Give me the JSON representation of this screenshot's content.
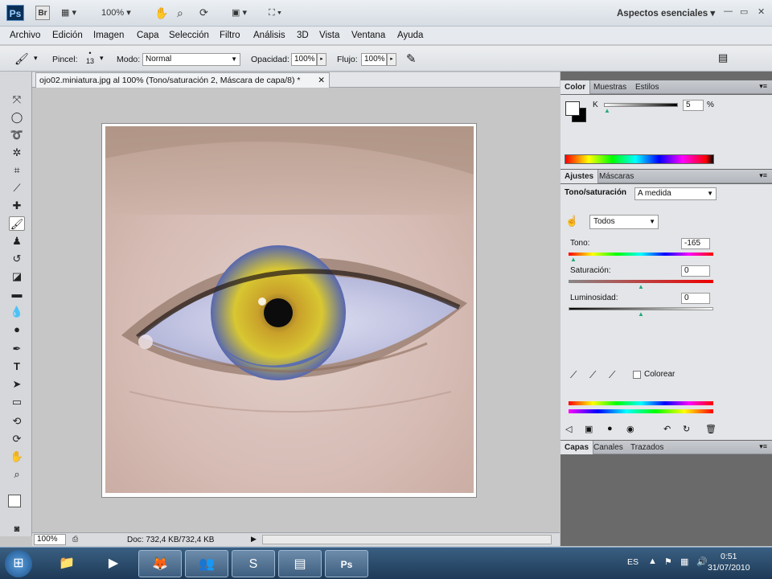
{
  "appbar": {
    "logo": "Ps",
    "bridge": "Br",
    "zoom": "100%",
    "workspace": "Aspectos esenciales",
    "window_controls": [
      "—",
      "▭",
      "✕"
    ]
  },
  "menu": [
    "Archivo",
    "Edición",
    "Imagen",
    "Capa",
    "Selección",
    "Filtro",
    "Análisis",
    "3D",
    "Vista",
    "Ventana",
    "Ayuda"
  ],
  "options": {
    "brush_label": "Pincel:",
    "brush_size": "13",
    "mode_label": "Modo:",
    "mode_value": "Normal",
    "opacity_label": "Opacidad:",
    "opacity_value": "100%",
    "flow_label": "Flujo:",
    "flow_value": "100%"
  },
  "document": {
    "tab_title": "ojo02.miniatura.jpg al 100% (Tono/saturación 2, Máscara de capa/8) *",
    "close": "✕"
  },
  "status": {
    "zoom": "100%",
    "doc_info": "Doc: 732,4 KB/732,4 KB"
  },
  "color_panel": {
    "tabs": [
      "Color",
      "Muestras",
      "Estilos"
    ],
    "channel_label": "K",
    "channel_value": "5",
    "unit": "%"
  },
  "adjust_panel": {
    "tabs": [
      "Ajustes",
      "Máscaras"
    ],
    "title": "Tono/saturación",
    "preset": "A medida",
    "channel": "Todos",
    "sliders": [
      {
        "label": "Tono:",
        "value": "-165",
        "pos": 0.04
      },
      {
        "label": "Saturación:",
        "value": "0",
        "pos": 0.5
      },
      {
        "label": "Luminosidad:",
        "value": "0",
        "pos": 0.5
      }
    ],
    "colorize_label": "Colorear"
  },
  "layers_panel": {
    "tabs": [
      "Capas",
      "Canales",
      "Trazados"
    ]
  },
  "taskbar": {
    "lang": "ES",
    "time": "0:51",
    "date": "31/07/2010"
  }
}
